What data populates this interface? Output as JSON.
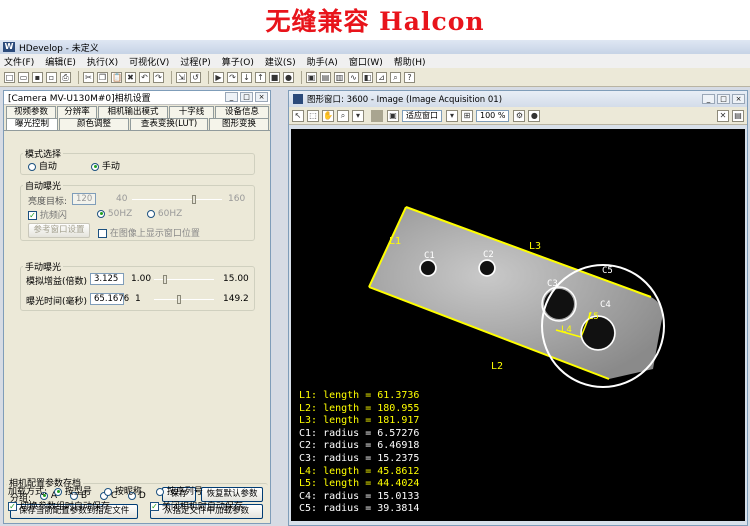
{
  "banner": {
    "title": "无缝兼容 Halcon"
  },
  "app": {
    "title": "HDevelop - 未定义",
    "logo": "W",
    "menu": [
      "文件(F)",
      "编辑(E)",
      "执行(X)",
      "可视化(V)",
      "过程(P)",
      "算子(O)",
      "建议(S)",
      "助手(A)",
      "窗口(W)",
      "帮助(H)"
    ]
  },
  "toolbar_icons": [
    "new-icon",
    "open-icon",
    "save-icon",
    "save-as-icon",
    "print-icon",
    "cut-icon",
    "copy-icon",
    "paste-icon",
    "delete-icon",
    "undo-icon",
    "redo-icon",
    "insert-icon",
    "reset-icon",
    "run-icon",
    "step-over-icon",
    "step-into-icon",
    "step-out-icon",
    "stop-icon",
    "breakpoint-icon",
    "graphics-window-icon",
    "image-icon",
    "histogram-icon",
    "profile-icon",
    "region-icon",
    "measure-icon",
    "inspect-icon",
    "help-icon"
  ],
  "panel": {
    "title": "[Camera MV-U130M#0]相机设置",
    "tabs_row1": [
      "视频参数",
      "分辨率",
      "相机输出模式",
      "十字线",
      "设备信息"
    ],
    "tabs_row2": [
      "曝光控制",
      "颜色调整",
      "查表变换(LUT)",
      "图形变换"
    ],
    "mode_group": {
      "label": "模式选择",
      "auto": "自动",
      "manual": "手动",
      "selected": "manual"
    },
    "auto_group": {
      "label": "自动曝光",
      "brightness_label": "亮度目标:",
      "brightness_value": "120",
      "brightness_min": "40",
      "brightness_max": "160",
      "brightness_level": 0.72,
      "flicker_label": "抗频闪",
      "flicker_checked": true,
      "hz50": "50HZ",
      "hz60": "60HZ",
      "ref_window_button": "参考窗口设置",
      "show_window_label": "在图像上显示窗口位置"
    },
    "manual_group": {
      "label": "手动曝光",
      "gain_label": "模拟增益(倍数)",
      "gain_value": "3.125",
      "gain_min": "1.00",
      "gain_max": "15.00",
      "gain_level": 0.17,
      "exposure_label": "曝光时间(毫秒)",
      "exposure_value": "65.1676",
      "exposure_min": "1",
      "exposure_max": "149.2",
      "exposure_level": 0.43
    },
    "config_group": {
      "label": "相机配置参数存档",
      "group_label": "分组:",
      "options": [
        "A",
        "B",
        "C",
        "D"
      ],
      "selected": "A",
      "save_button": "保存",
      "restore_button": "恢复默认参数",
      "save_to_file_button": "保存当前配置参数到指定文件",
      "load_from_file_button": "从指定文件中加载参数",
      "load_mode_label": "加载方式:",
      "load_by_type": "按型号",
      "load_by_name": "按昵称",
      "load_by_serial": "按序列号",
      "load_selected": "by_type",
      "auto_save_switch": "切换参数组时自动保存",
      "auto_save_close": "关闭相机时自动保存"
    }
  },
  "graphics": {
    "title": "图形窗口: 3600 - Image (Image Acquisition 01)",
    "zoom_select": "适应窗口",
    "zoom_percent": "100 %",
    "part_label_color": "#ffff00",
    "labels": {
      "L1": "L1",
      "L2": "L2",
      "L3": "L3",
      "L4": "L4",
      "L5": "L5",
      "C1": "C1",
      "C2": "C2",
      "C3": "C3",
      "C4": "C4",
      "C5": "C5"
    },
    "results": [
      {
        "text": "L1: length = 61.3736",
        "color": "#ffff00"
      },
      {
        "text": "L2: length = 180.955",
        "color": "#ffff00"
      },
      {
        "text": "L3: length = 181.917",
        "color": "#ffff00"
      },
      {
        "text": "C1: radius = 6.57276",
        "color": "#ffffff"
      },
      {
        "text": "C2: radius = 6.46918",
        "color": "#ffffff"
      },
      {
        "text": "C3: radius = 15.2375",
        "color": "#ffffff"
      },
      {
        "text": "L4: length = 45.8612",
        "color": "#ffff00"
      },
      {
        "text": "L5: length = 44.4024",
        "color": "#ffff00"
      },
      {
        "text": "C4: radius = 15.0133",
        "color": "#ffffff"
      },
      {
        "text": "C5: radius = 39.3814",
        "color": "#ffffff"
      }
    ]
  }
}
